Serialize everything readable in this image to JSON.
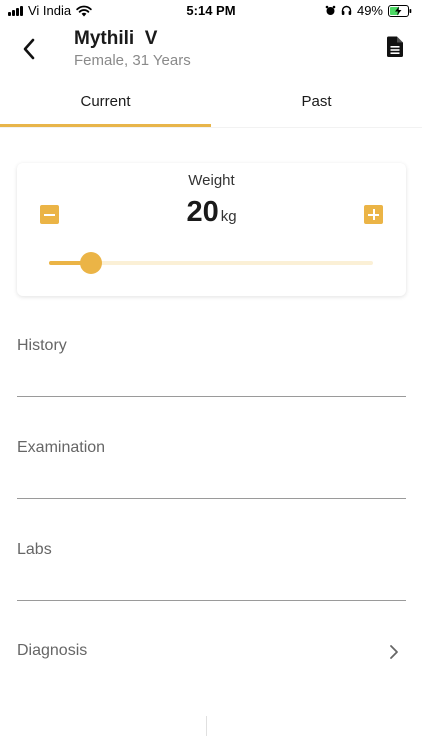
{
  "status_bar": {
    "carrier": "Vi India",
    "time": "5:14 PM",
    "battery_percent": "49%",
    "icons": [
      "signal-icon",
      "wifi-icon",
      "alarm-icon",
      "headphones-icon",
      "battery-charging-icon"
    ]
  },
  "header": {
    "patient_name": "Mythili  V",
    "patient_details": "Female, 31 Years",
    "back_icon": "chevron-left-icon",
    "document_icon": "document-icon"
  },
  "tabs": [
    {
      "label": "Current",
      "selected": true
    },
    {
      "label": "Past",
      "selected": false
    }
  ],
  "weight": {
    "label": "Weight",
    "value": "20",
    "unit": "kg",
    "slider_fraction": 0.13,
    "decrement_icon": "minus-icon",
    "increment_icon": "plus-icon"
  },
  "sections": {
    "history": "History",
    "examination": "Examination",
    "labs": "Labs",
    "diagnosis": "Diagnosis"
  },
  "colors": {
    "accent": "#ebb446",
    "tab_underline": "#e8b54a",
    "slider_track": "#fbf0d6",
    "muted_text": "#8a8a8a",
    "divider": "#9a9a9a"
  }
}
